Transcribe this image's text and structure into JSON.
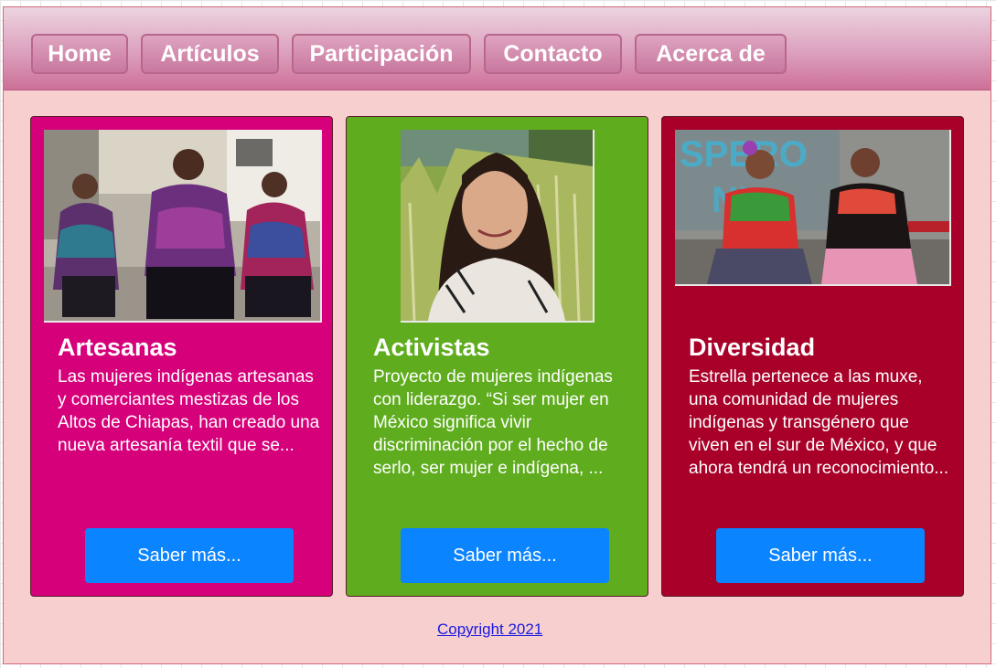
{
  "nav": {
    "items": [
      "Home",
      "Artículos",
      "Participación",
      "Contacto",
      "Acerca de"
    ]
  },
  "cards": [
    {
      "title": "Artesanas",
      "text": "Las mujeres indígenas artesanas y comerciantes mestizas de los Altos de Chiapas, han creado una nueva artesanía textil que se...",
      "button": "Saber más...",
      "color": "#d6007a"
    },
    {
      "title": "Activistas",
      "text": "Proyecto de mujeres indígenas con liderazgo. “Si ser mujer en México significa vivir discriminación por el hecho de serlo, ser mujer e indígena, ...",
      "button": "Saber más...",
      "color": "#5fad1e"
    },
    {
      "title": "Diversidad",
      "text": "Estrella pertenece a las muxe, una comunidad de mujeres indígenas y transgénero que viven en el sur de México, y que ahora tendrá un reconocimiento...",
      "button": "Saber más...",
      "color": "#a80028"
    }
  ],
  "footer": {
    "copyright": "Copyright 2021"
  },
  "colors": {
    "page_background": "#f7cfcf",
    "button_blue": "#0a84ff",
    "link": "#1a1ae0"
  }
}
